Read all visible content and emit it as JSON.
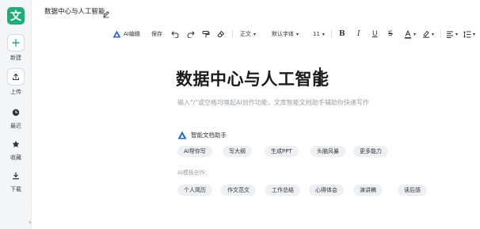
{
  "app": {
    "logo_char": "文",
    "accent": "#1fae7a"
  },
  "sidebar": {
    "items": [
      {
        "label": "新建",
        "icon": "plus-icon"
      },
      {
        "label": "上传",
        "icon": "upload-icon"
      },
      {
        "label": "最近",
        "icon": "clock-icon"
      },
      {
        "label": "收藏",
        "icon": "star-icon"
      },
      {
        "label": "下载",
        "icon": "download-icon"
      }
    ],
    "collapse_glyph": "›"
  },
  "header": {
    "doc_title": "数据中心与人工智能"
  },
  "toolbar": {
    "ai_label": "AI编辑",
    "save_label": "保存",
    "paragraph_style": "正文",
    "font_family": "默认字体",
    "font_size": "11"
  },
  "document": {
    "heading": "数据中心与人工智能",
    "hint": "输入\"/\"或空格可唤起AI创作功能，文库智能文档助手辅助你快速写作"
  },
  "assistant": {
    "label": "智能文档助手",
    "actions": [
      "AI帮你写",
      "写大纲",
      "生成PPT",
      "头脑风暴",
      "更多能力"
    ]
  },
  "templates": {
    "label": "AI模板创作：",
    "items": [
      "个人简历",
      "作文范文",
      "工作总结",
      "心得体会",
      "演讲稿",
      "读后感"
    ]
  }
}
